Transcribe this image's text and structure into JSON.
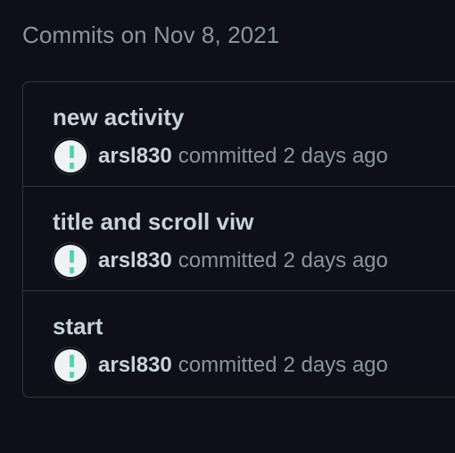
{
  "heading": "Commits on Nov 8, 2021",
  "commits": [
    {
      "title": "new activity",
      "author": "arsl830",
      "action": "committed",
      "time": "2 days ago"
    },
    {
      "title": "title and scroll viw",
      "author": "arsl830",
      "action": "committed",
      "time": "2 days ago"
    },
    {
      "title": "start",
      "author": "arsl830",
      "action": "committed",
      "time": "2 days ago"
    }
  ],
  "colors": {
    "background": "#0d1117",
    "border": "#30363d",
    "text_primary": "#c9d1d9",
    "text_muted": "#8b949e",
    "avatar_accent": "#4fd6b0"
  }
}
